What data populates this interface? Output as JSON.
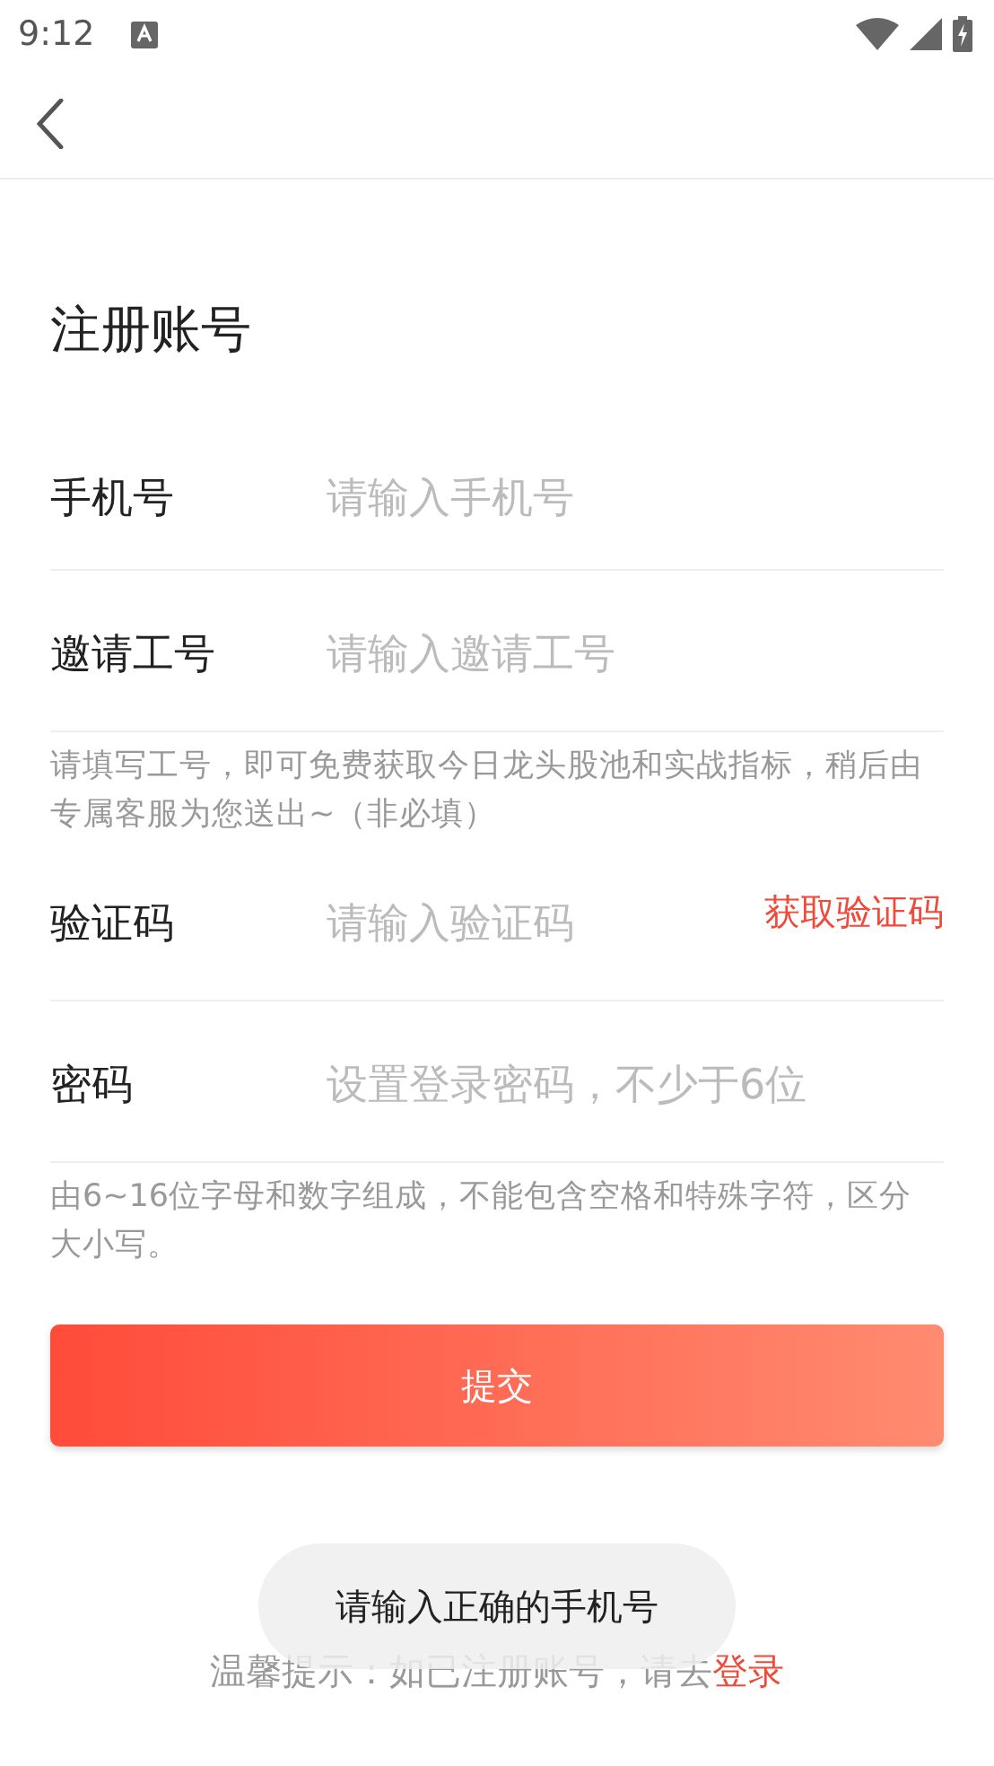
{
  "status_bar": {
    "time": "9:12"
  },
  "title": "注册账号",
  "fields": [
    {
      "label": "手机号",
      "placeholder": "请输入手机号"
    },
    {
      "label": "邀请工号",
      "placeholder": "请输入邀请工号",
      "hint": "请填写工号，即可免费获取今日龙头股池和实战指标，稍后由专属客服为您送出~（非必填）"
    },
    {
      "label": "验证码",
      "placeholder": "请输入验证码",
      "action": "获取验证码"
    },
    {
      "label": "密码",
      "placeholder": "设置登录密码，不少于6位",
      "hint": "由6~16位字母和数字组成，不能包含空格和特殊字符，区分大小写。"
    }
  ],
  "submit_button": "提交",
  "footer": {
    "text": "温馨提示：如已注册账号，请去",
    "link": "登录"
  },
  "toast": "请输入正确的手机号"
}
